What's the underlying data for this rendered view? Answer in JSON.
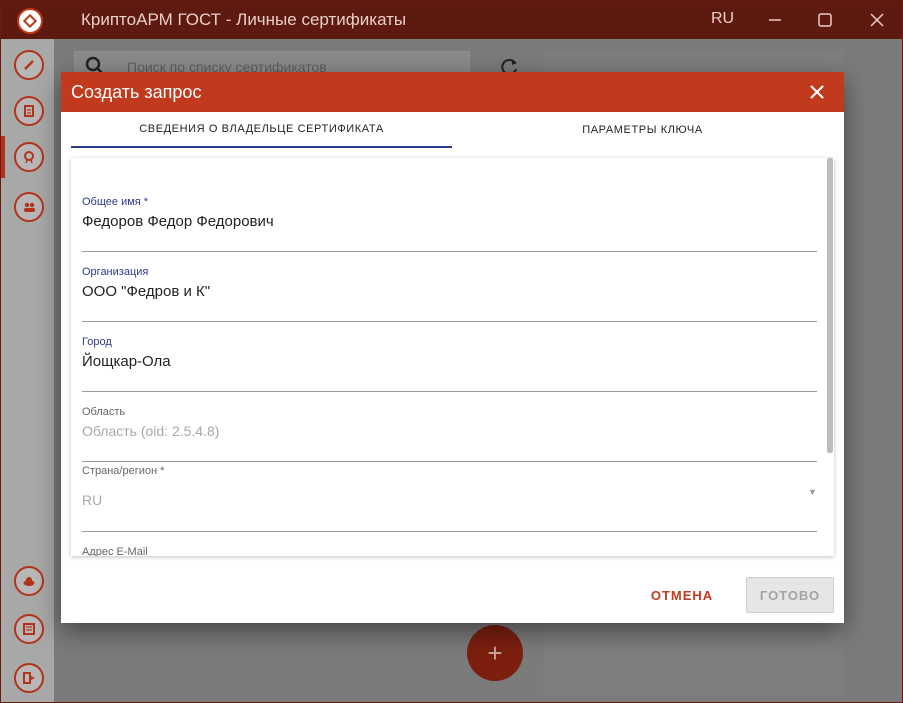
{
  "window": {
    "title": "КриптоАРМ ГОСТ - Личные сертификаты",
    "language": "RU",
    "controls": [
      "minimize-icon",
      "maximize-icon",
      "close-icon"
    ]
  },
  "sidebar": {
    "top_items": [
      {
        "icon": "sign-pen-icon"
      },
      {
        "icon": "documents-icon"
      },
      {
        "icon": "certificate-icon",
        "active": true
      },
      {
        "icon": "contacts-icon"
      }
    ],
    "bottom_items": [
      {
        "icon": "cloud-icon"
      },
      {
        "icon": "journal-icon"
      },
      {
        "icon": "exit-icon"
      }
    ]
  },
  "background": {
    "search_placeholder": "Поиск по списку сертификатов",
    "fab_label": "+"
  },
  "dialog": {
    "title": "Создать запрос",
    "tabs": [
      {
        "label": "СВЕДЕНИЯ О ВЛАДЕЛЬЦЕ СЕРТИФИКАТА",
        "active": true
      },
      {
        "label": "ПАРАМЕТРЫ КЛЮЧА",
        "active": false
      }
    ],
    "fields": {
      "common_name": {
        "label": "Общее имя *",
        "value": "Федоров Федор Федорович"
      },
      "organization": {
        "label": "Организация",
        "value": "ООО \"Федров и К\""
      },
      "city": {
        "label": "Город",
        "value": "Йощкар-Ола"
      },
      "region": {
        "label": "Область",
        "placeholder": "Область (oid: 2.5.4.8)"
      },
      "country": {
        "label": "Страна/регион *",
        "value": "RU"
      },
      "email": {
        "label": "Адрес E-Mail"
      }
    },
    "buttons": {
      "cancel": "ОТМЕНА",
      "done": "ГОТОВО"
    }
  },
  "colors": {
    "accent": "#c23a1d",
    "titlebar": "#5e1a10",
    "tab_indicator": "#2d3a8c"
  }
}
